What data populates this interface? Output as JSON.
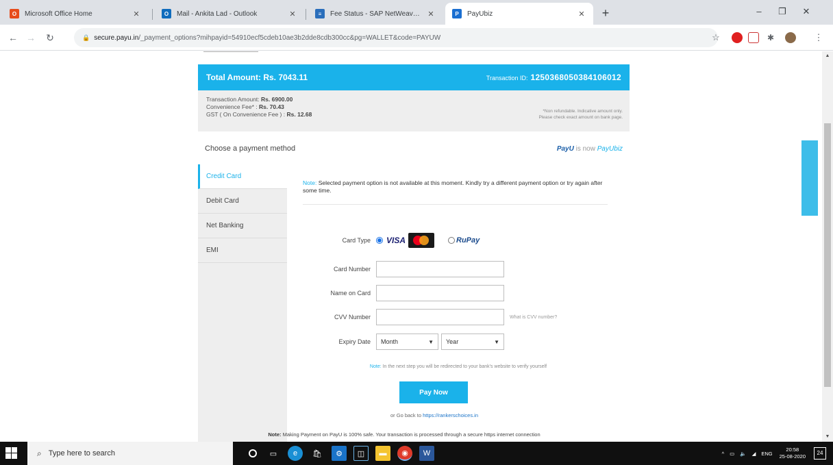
{
  "browser": {
    "tabs": [
      {
        "title": "Microsoft Office Home",
        "fav_color": "#e74c1b"
      },
      {
        "title": "Mail - Ankita Lad - Outlook",
        "fav_color": "#0f6cbd"
      },
      {
        "title": "Fee Status - SAP NetWeaver Po",
        "fav_color": "#2a6ebb"
      },
      {
        "title": "PayUbiz",
        "fav_color": "#1a6fd1"
      }
    ],
    "url_host": "secure.payu.in",
    "url_rest": "/_payment_options?mihpayid=54910ecf5cdeb10ae3b2dde8cdb300cc&pg=WALLET&code=PAYUW",
    "newtab_label": "+",
    "minimize_label": "–",
    "restore_label": "❐",
    "close_label": "✕"
  },
  "payment": {
    "total_amount": "Total Amount: Rs. 7043.11",
    "transaction_label": "Transaction ID:",
    "transaction_id": "1250368050384106012",
    "breakup": {
      "txn_amount_label": "Transaction Amount:",
      "txn_amount": "Rs. 6900.00",
      "conv_fee_label": "Convenience Fee* :",
      "conv_fee": "Rs. 70.43",
      "gst_label": "GST ( On Convenience Fee ) :",
      "gst": "Rs. 12.68",
      "note_line1": "*Non refundable. Indicative amount only.",
      "note_line2": "Please check exact amount on bank page."
    },
    "choose_title": "Choose a payment method",
    "brand_old": "PayU",
    "brand_mid": "is now",
    "brand_new": "PayUbiz",
    "tabs": [
      "Credit Card",
      "Debit Card",
      "Net Banking",
      "EMI"
    ],
    "note_label": "Note:",
    "note_text": "Selected payment option is not available at this moment. Kindly try a different payment option or try again after some time.",
    "card_type_label": "Card Type",
    "visa_text": "VISA",
    "rupay_text": "RuPay",
    "card_number_label": "Card Number",
    "name_on_card_label": "Name on Card",
    "cvv_label": "CVV Number",
    "cvv_help": "What is CVV number?",
    "expiry_label": "Expiry Date",
    "month_value": "Month",
    "year_value": "Year",
    "redirect_label": "Note:",
    "redirect_text": "In the next step you will be redirected to your bank's website to verify yourself",
    "pay_button": "Pay Now",
    "goback_text": "or Go back to",
    "goback_link": "https://rankerschoices.in",
    "safe_label": "Note:",
    "safe_text": "Making Payment on PayU is 100% safe. Your transaction is processed through a secure https internet connection"
  },
  "taskbar": {
    "search_placeholder": "Type here to search",
    "lang": "ENG",
    "time": "20:58",
    "date": "25-08-2020",
    "notif_count": "24"
  },
  "colors": {
    "accent": "#1ab2ea",
    "page_bg": "#ffffff",
    "panel_grey": "#eeeeee"
  }
}
